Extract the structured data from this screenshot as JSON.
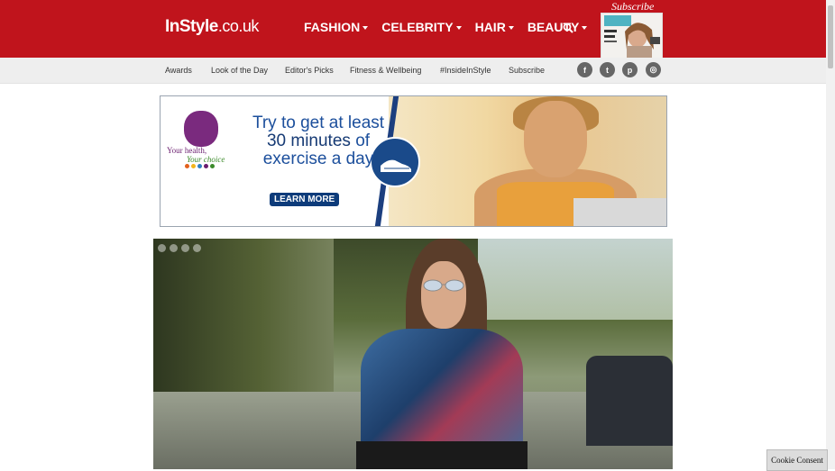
{
  "header": {
    "logo_main": "InStyle",
    "logo_tld": ".co.uk",
    "nav": [
      {
        "label": "FASHION"
      },
      {
        "label": "CELEBRITY"
      },
      {
        "label": "HAIR"
      },
      {
        "label": "BEAUTY"
      }
    ],
    "subscribe_label": "Subscribe",
    "search_icon": "search-icon",
    "colors": {
      "brand_red": "#c0141c"
    }
  },
  "subnav": {
    "links": [
      {
        "label": "Awards"
      },
      {
        "label": "Look of the Day"
      },
      {
        "label": "Editor's Picks"
      },
      {
        "label": "Fitness & Wellbeing"
      },
      {
        "label": "#InsideInStyle"
      },
      {
        "label": "Subscribe"
      }
    ],
    "social": [
      {
        "icon": "facebook-icon",
        "glyph": "f"
      },
      {
        "icon": "twitter-icon",
        "glyph": "t"
      },
      {
        "icon": "pinterest-icon",
        "glyph": "p"
      },
      {
        "icon": "instagram-icon",
        "glyph": "◎"
      }
    ]
  },
  "ad": {
    "logo_line1": "Your health,",
    "logo_line2": "Your choice",
    "headline_pre": "Try to get at least",
    "headline_bold": "30 minutes",
    "headline_mid": "of",
    "headline_post": "exercise a day",
    "cta": "LEARN MORE"
  },
  "cookie": {
    "label": "Cookie Consent"
  }
}
